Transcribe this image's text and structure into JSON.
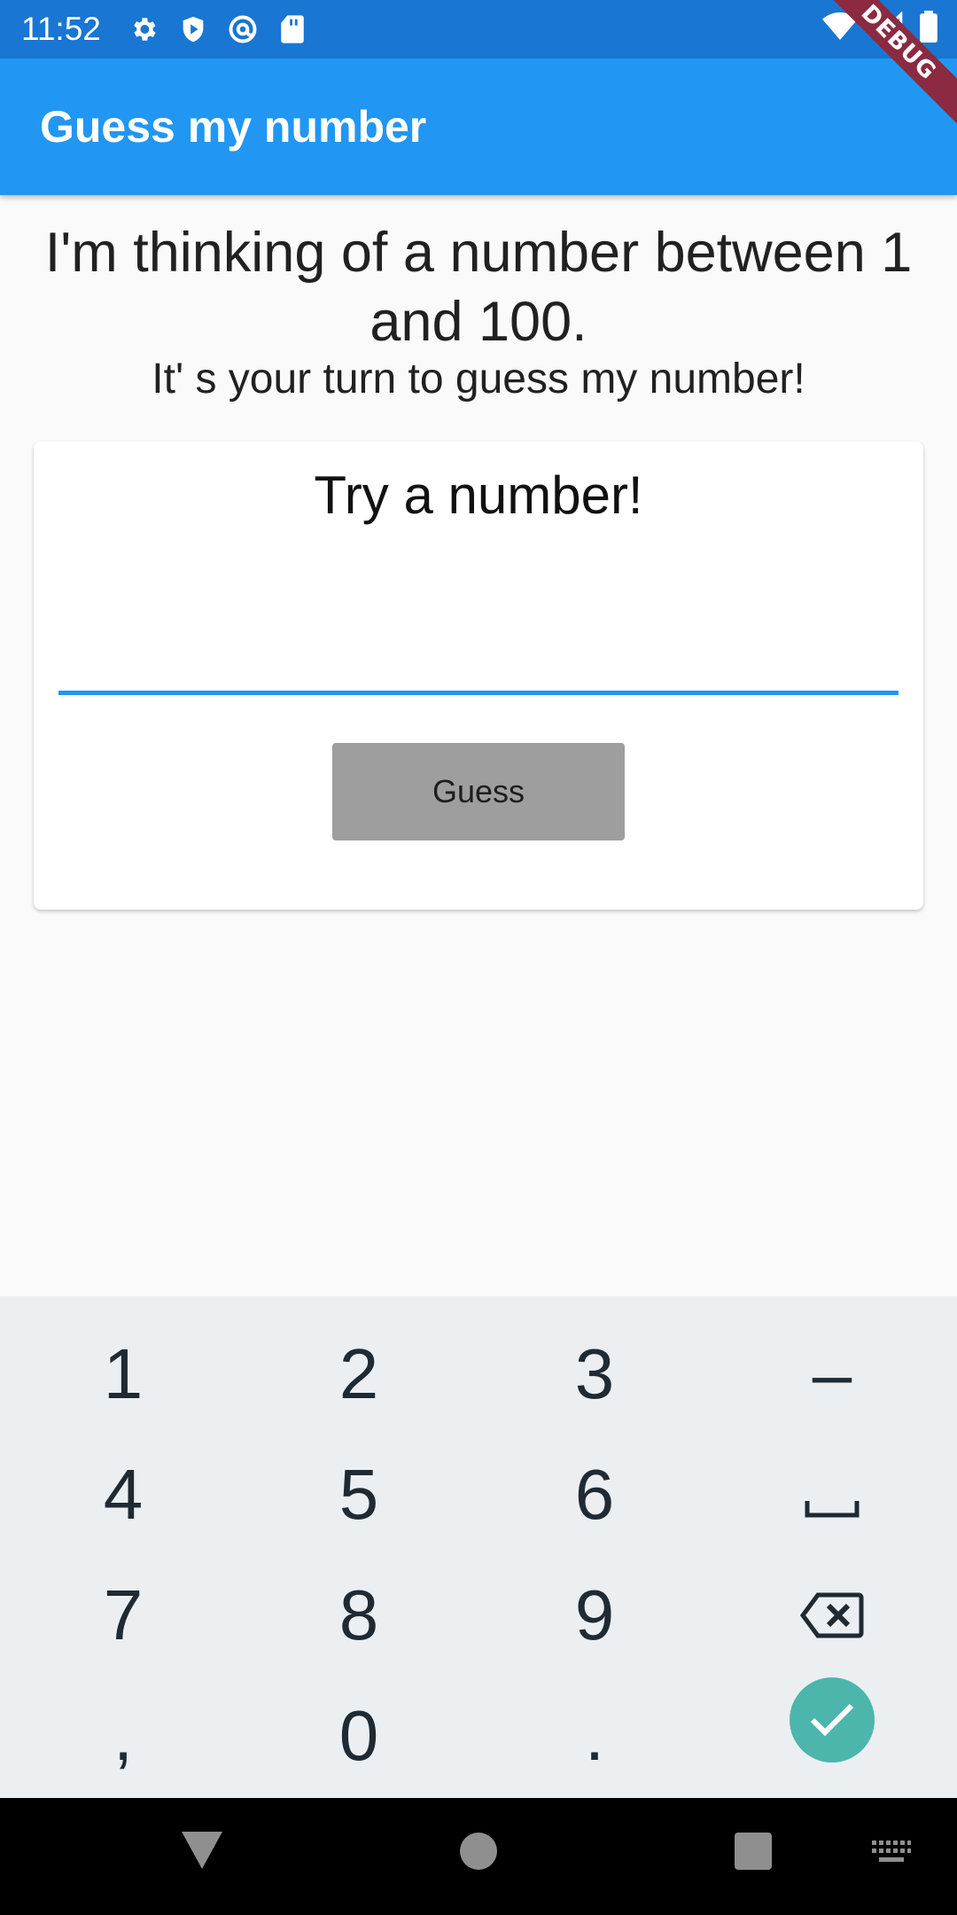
{
  "status_bar": {
    "time": "11:52",
    "left_icons": [
      "gear-icon",
      "shield-play-icon",
      "at-sign-icon",
      "sd-card-icon"
    ],
    "right_icons": [
      "wifi-icon",
      "signal-icon",
      "battery-icon"
    ]
  },
  "debug_banner": "DEBUG",
  "app_bar": {
    "title": "Guess my number"
  },
  "intro": {
    "title": "I'm thinking of a number between 1 and 100.",
    "subtitle": "It' s your turn to guess my number!"
  },
  "card": {
    "title": "Try a number!",
    "input_value": "",
    "button_label": "Guess"
  },
  "keyboard": {
    "rows": [
      [
        "1",
        "2",
        "3",
        "–"
      ],
      [
        "4",
        "5",
        "6",
        "space-icon"
      ],
      [
        "7",
        "8",
        "9",
        "backspace-icon"
      ],
      [
        ",",
        "0",
        ".",
        "done-check-icon"
      ]
    ],
    "accent_color": "#4db6ac"
  },
  "nav_bar": {
    "items": [
      "back-triangle-icon",
      "home-circle-icon",
      "recents-square-icon",
      "keyboard-switch-icon"
    ]
  },
  "colors": {
    "status_bar": "#1976d2",
    "app_bar": "#2196f3",
    "button": "#9e9e9e",
    "input_underline": "#2196f3",
    "keyboard_bg": "#eceff1"
  }
}
